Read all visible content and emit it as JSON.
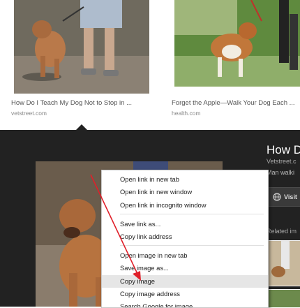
{
  "results": [
    {
      "title": "How Do I Teach My Dog Not to Stop in ...",
      "source": "vetstreet.com"
    },
    {
      "title": "Forget the Apple—Walk Your Dog Each ...",
      "source": "health.com"
    }
  ],
  "side_panel": {
    "title": "How D",
    "source": "Vetstreet.c",
    "description": "Man walki",
    "visit_label": "Visit",
    "related_label": "Related im"
  },
  "context_menu": {
    "items": [
      "Open link in new tab",
      "Open link in new window",
      "Open link in incognito window",
      "Save link as...",
      "Copy link address",
      "Open image in new tab",
      "Save image as...",
      "Copy image",
      "Copy image address",
      "Search Google for image"
    ],
    "highlighted": "Copy image"
  },
  "colors": {
    "panel_bg": "#222222",
    "annotation_arrow": "#e0202a",
    "menu_highlight": "#e6e6e6"
  }
}
